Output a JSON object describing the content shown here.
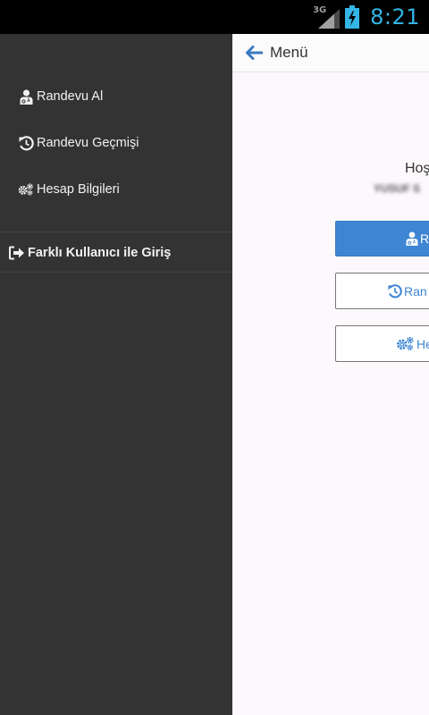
{
  "status_bar": {
    "network": "3G",
    "time": "8:21"
  },
  "drawer": {
    "items": [
      {
        "label": "Randevu Al",
        "icon": "doctor-icon"
      },
      {
        "label": "Randevu Geçmişi",
        "icon": "history-icon"
      },
      {
        "label": "Hesap Bilgileri",
        "icon": "gears-icon"
      }
    ],
    "logout": {
      "label": "Farklı Kullanıcı ile Giriş",
      "icon": "sign-out-icon"
    }
  },
  "action_bar": {
    "title": "Menü",
    "back_icon": "arrow-left-icon"
  },
  "main": {
    "greeting": "Hoş",
    "username": "YUSUF S",
    "buttons": [
      {
        "label": "R",
        "icon": "doctor-icon"
      },
      {
        "label": "Ran",
        "icon": "history-icon"
      },
      {
        "label": "He",
        "icon": "gears-icon"
      }
    ]
  },
  "colors": {
    "status_time": "#33b5e5",
    "drawer_bg": "#333333",
    "accent": "#3e85d3",
    "panel_bg": "#fcf8fc"
  }
}
